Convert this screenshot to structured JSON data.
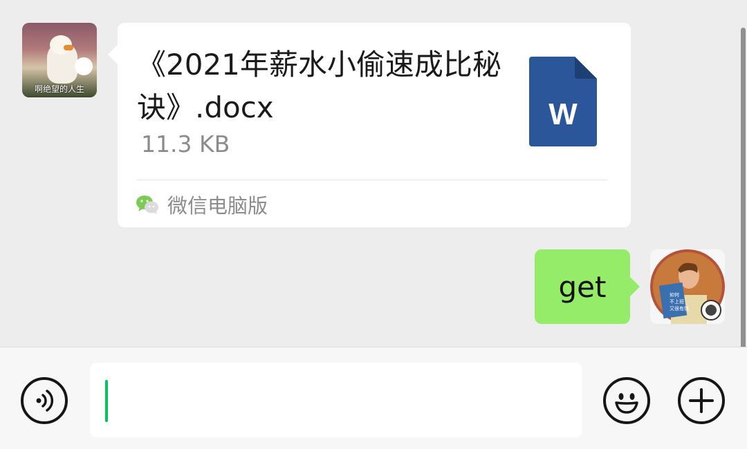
{
  "conversation": {
    "incoming_file": {
      "sender_avatar": {
        "caption": "啊绝望的人生",
        "icon": "duck-avatar-icon"
      },
      "file_name": "《2021年薪水小偷速成比秘诀》.docx",
      "file_size": "11.3 KB",
      "file_icon": "word-document-icon",
      "file_icon_letter": "W",
      "source_label": "微信电脑版",
      "source_icon": "wechat-icon"
    },
    "outgoing_message": {
      "text": "get",
      "avatar_icon": "reading-man-avatar-icon",
      "avatar_book_text": [
        "如何",
        "不上班",
        "又很有钱"
      ]
    }
  },
  "input_bar": {
    "voice_icon": "voice-icon",
    "text_value": "",
    "emoji_icon": "emoji-icon",
    "more_icon": "plus-icon"
  },
  "colors": {
    "background": "#ededed",
    "incoming_bubble": "#ffffff",
    "outgoing_bubble": "#95ec69",
    "word_blue": "#2b579a",
    "caret_green": "#07c160",
    "secondary_text": "#8c8c8c"
  }
}
